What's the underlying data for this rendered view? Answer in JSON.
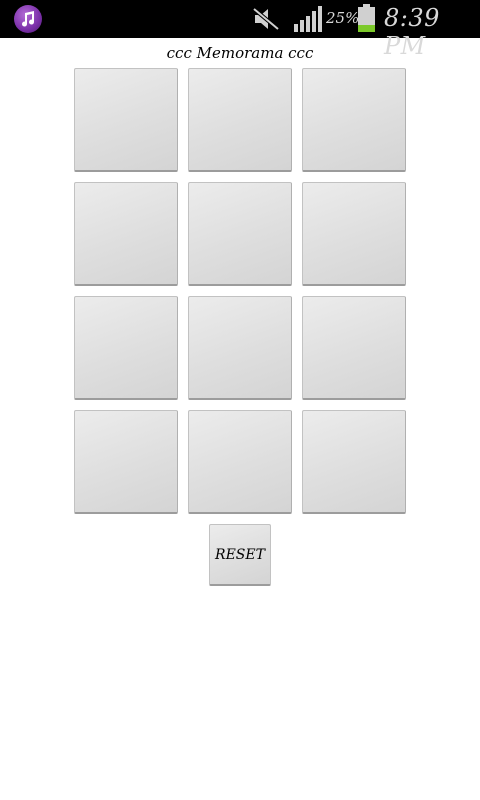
{
  "status_bar": {
    "app_icon": "music-note-icon",
    "battery_percent": "25%",
    "battery_level": 0.25,
    "time": "8:39 PM",
    "icons": [
      "mute-icon",
      "signal-icon",
      "battery-icon"
    ]
  },
  "app": {
    "title": "ccc Memorama ccc",
    "tile_rows": 4,
    "tile_columns": 3,
    "tiles": [
      "",
      "",
      "",
      "",
      "",
      "",
      "",
      "",
      "",
      "",
      "",
      ""
    ],
    "reset_label": "RESET"
  }
}
